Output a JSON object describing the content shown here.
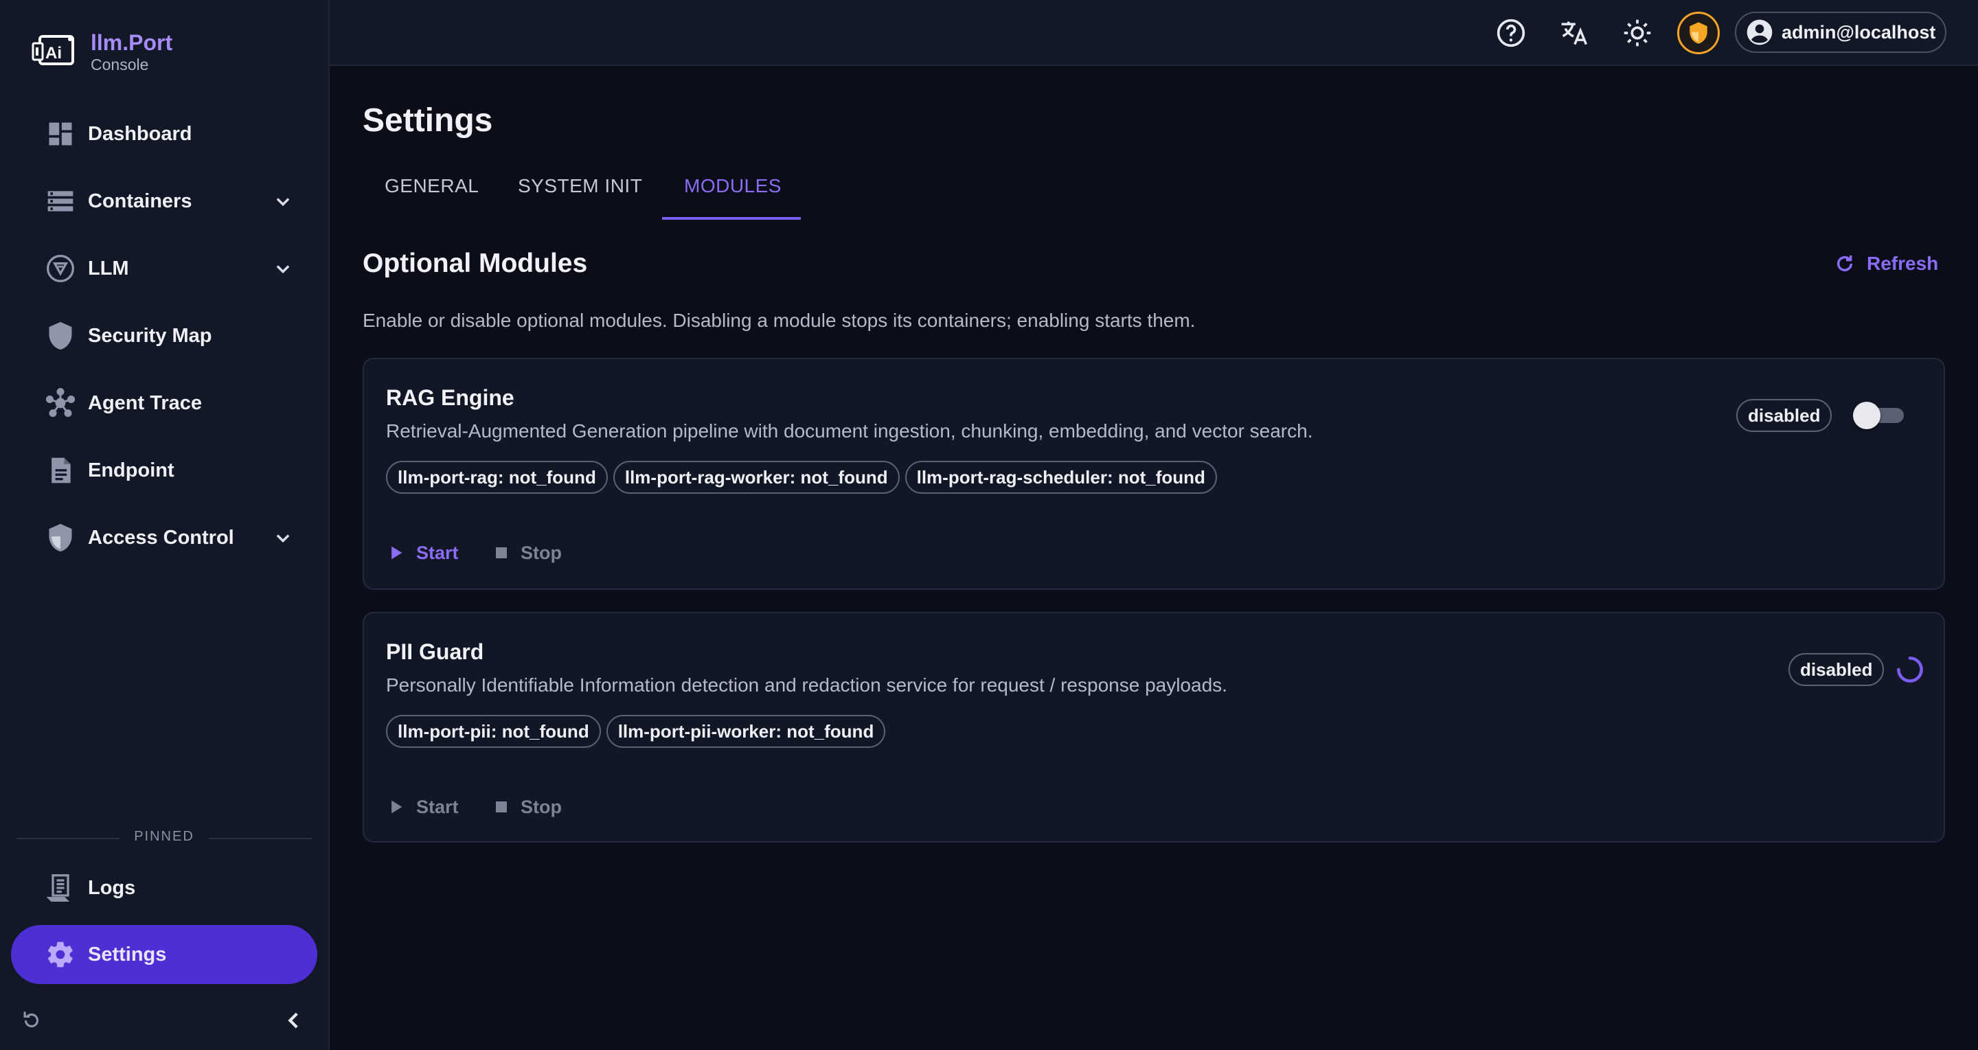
{
  "brand": {
    "name": "llm.Port",
    "subtitle": "Console"
  },
  "sidebar": {
    "items": [
      {
        "label": "Dashboard",
        "icon": "dashboard-icon"
      },
      {
        "label": "Containers",
        "icon": "containers-icon",
        "expandable": true
      },
      {
        "label": "LLM",
        "icon": "llm-icon",
        "expandable": true
      },
      {
        "label": "Security Map",
        "icon": "shield-icon"
      },
      {
        "label": "Agent Trace",
        "icon": "hub-icon"
      },
      {
        "label": "Endpoint",
        "icon": "document-icon"
      },
      {
        "label": "Access Control",
        "icon": "access-shield-icon",
        "expandable": true
      }
    ],
    "pinned_label": "PINNED",
    "pinned": [
      {
        "label": "Logs",
        "icon": "logs-icon"
      },
      {
        "label": "Settings",
        "icon": "gear-icon",
        "active": true
      }
    ]
  },
  "topbar": {
    "user": "admin@localhost"
  },
  "page": {
    "title": "Settings",
    "tabs": [
      {
        "label": "GENERAL"
      },
      {
        "label": "SYSTEM INIT"
      },
      {
        "label": "MODULES",
        "active": true
      }
    ],
    "section_title": "Optional Modules",
    "refresh_label": "Refresh",
    "section_description": "Enable or disable optional modules. Disabling a module stops its containers; enabling starts them."
  },
  "modules": [
    {
      "name": "RAG Engine",
      "description": "Retrieval-Augmented Generation pipeline with document ingestion, chunking, embedding, and vector search.",
      "containers": [
        "llm-port-rag: not_found",
        "llm-port-rag-worker: not_found",
        "llm-port-rag-scheduler: not_found"
      ],
      "status": "disabled",
      "start_label": "Start",
      "stop_label": "Stop"
    },
    {
      "name": "PII Guard",
      "description": "Personally Identifiable Information detection and redaction service for request / response payloads.",
      "containers": [
        "llm-port-pii: not_found",
        "llm-port-pii-worker: not_found"
      ],
      "status": "disabled",
      "start_label": "Start",
      "stop_label": "Stop"
    }
  ],
  "colors": {
    "accent": "#7c5cf5",
    "active_nav": "#4d2fd4",
    "warning": "#f5a524"
  }
}
